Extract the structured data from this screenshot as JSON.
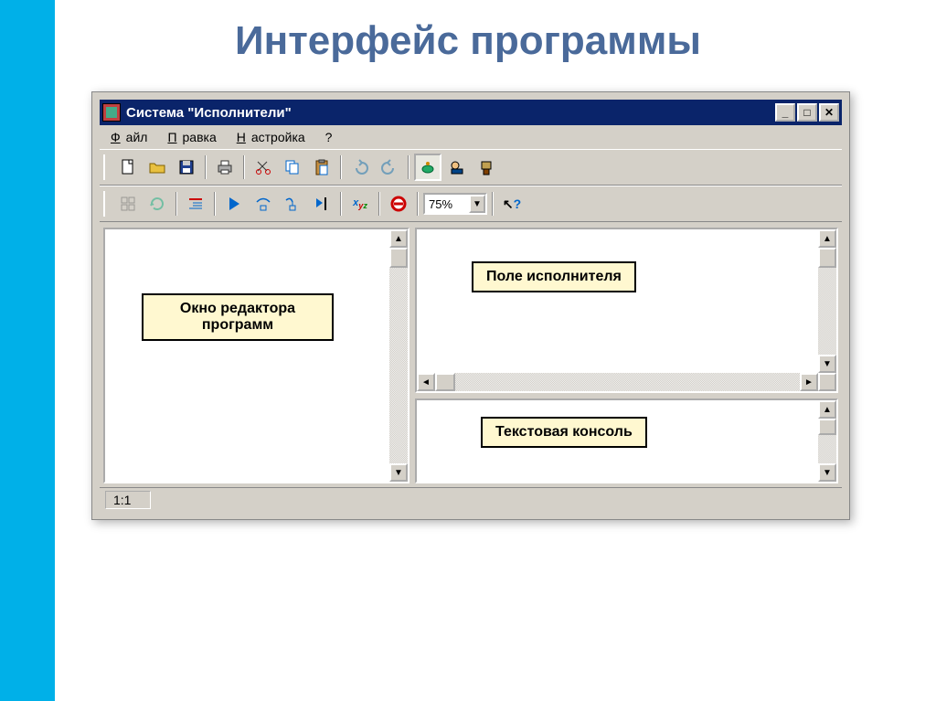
{
  "page_title": "Интерфейс программы",
  "window": {
    "title": "Система \"Исполнители\"",
    "controls": {
      "minimize": "_",
      "maximize": "□",
      "close": "✕"
    }
  },
  "menu": {
    "file": "Файл",
    "edit": "Правка",
    "settings": "Настройка",
    "help": "?"
  },
  "toolbar1": {
    "new": "new-file",
    "open": "open-file",
    "save": "save",
    "print": "print",
    "cut": "cut",
    "copy": "copy",
    "paste": "paste",
    "undo": "undo",
    "redo": "redo",
    "exec_turtle": "turtle",
    "exec_draw": "helicopter",
    "exec_robot": "robot"
  },
  "toolbar2": {
    "grid": "grid",
    "refresh": "refresh",
    "indent": "indent",
    "run": "run",
    "step_over": "step-over",
    "step_into": "step-into",
    "step_cursor": "step-cursor",
    "vars": "xyz",
    "stop": "stop",
    "zoom_value": "75%",
    "pointer_help": "pointer-help"
  },
  "panes": {
    "editor_label": "Окно редактора\nпрограмм",
    "field_label": "Поле исполнителя",
    "console_label": "Текстовая консоль"
  },
  "status": {
    "cursor": "1:1"
  }
}
